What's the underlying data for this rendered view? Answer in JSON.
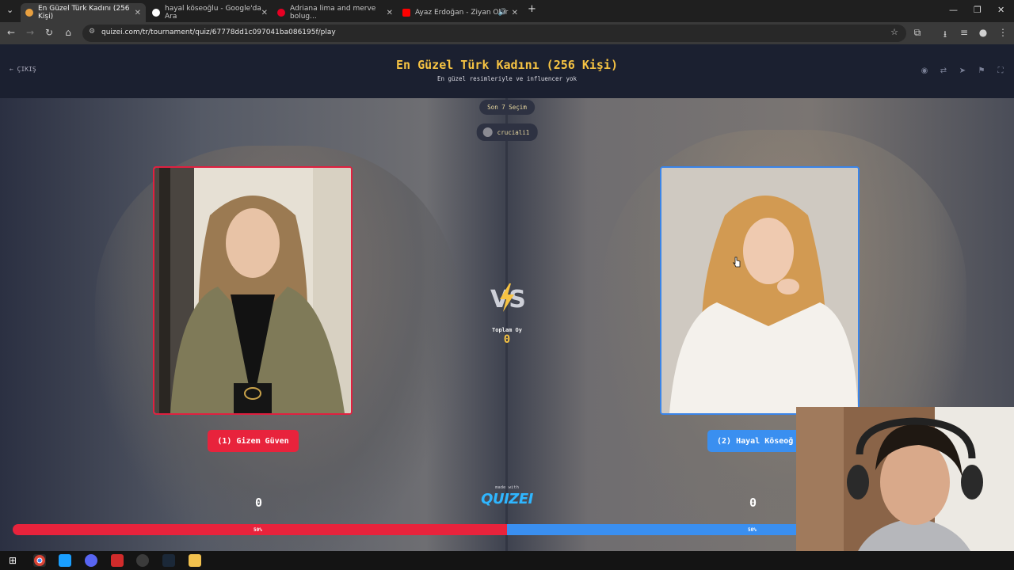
{
  "browser": {
    "tabs": [
      {
        "label": "En Güzel Türk Kadını (256 Kişi)",
        "active": true
      },
      {
        "label": "hayal köseoğlu - Google'da Ara",
        "active": false
      },
      {
        "label": "Adriana lima and merve bolug...",
        "active": false
      },
      {
        "label": "Ayaz Erdoğan - Ziyan Olur",
        "active": false
      }
    ],
    "url": "quizei.com/tr/tournament/quiz/67778dd1c097041ba086195f/play"
  },
  "header": {
    "exit_label": "ÇIKIŞ",
    "title": "En Güzel Türk Kadını (256 Kişi)",
    "subtitle": "En güzel resimleriyle ve influencer yok"
  },
  "round": {
    "stage_label": "Son 7 Seçim",
    "user": "cruciali1"
  },
  "vs": {
    "total_label": "Toplam Oy",
    "total_value": "0"
  },
  "left": {
    "name": "(1) Gizem Güven",
    "score": "0",
    "percent": "50%"
  },
  "right": {
    "name": "(2) Hayal Köseoğ",
    "score": "0",
    "percent": "50%"
  },
  "footer": {
    "made_with": "made with",
    "brand": "QUIZEI"
  },
  "colors": {
    "accent_red": "#e8233c",
    "accent_blue": "#3a8ff0",
    "title_gold": "#f6c343"
  }
}
